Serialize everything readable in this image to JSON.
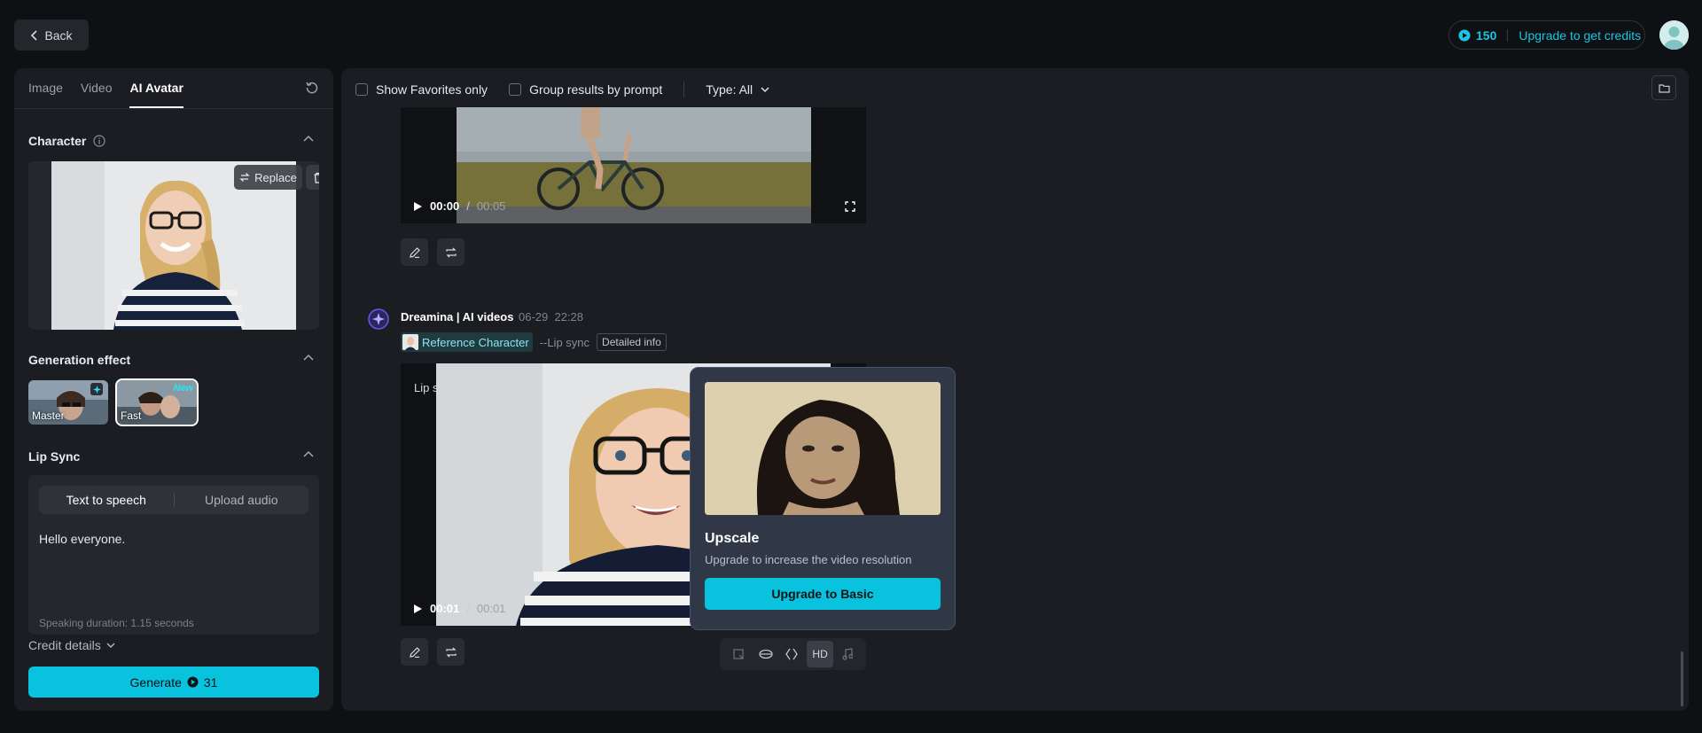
{
  "topbar": {
    "back_label": "Back",
    "credits_count": "150",
    "upgrade_label": "Upgrade to get credits"
  },
  "left": {
    "tabs": [
      {
        "label": "Image"
      },
      {
        "label": "Video"
      },
      {
        "label": "AI Avatar"
      }
    ],
    "character_title": "Character",
    "replace_label": "Replace",
    "generation_effect_title": "Generation effect",
    "effects": [
      {
        "label": "Master"
      },
      {
        "label": "Fast",
        "badge": "New"
      }
    ],
    "lip_sync_title": "Lip Sync",
    "lip_tabs": [
      {
        "label": "Text to speech"
      },
      {
        "label": "Upload audio"
      }
    ],
    "speech_text": "Hello everyone.",
    "duration_text": "Speaking duration: 1.15 seconds",
    "credit_details_label": "Credit details",
    "generate_label": "Generate",
    "generate_cost": "31"
  },
  "main": {
    "toolbar": {
      "show_favorites": "Show Favorites only",
      "group_results": "Group results by prompt",
      "type_filter": "Type: All"
    },
    "video1": {
      "current": "00:00",
      "total": "00:05"
    },
    "generation": {
      "title": "Dreamina | AI videos",
      "date": "06-29",
      "time": "22:28",
      "ref_label": "Reference Character",
      "lip_tag": "--Lip sync",
      "detail_label": "Detailed info"
    },
    "video2": {
      "overlay_label": "Lip sync",
      "current": "00:01",
      "total": "00:01"
    },
    "hover_tools": {
      "hd_label": "HD"
    },
    "popover": {
      "title": "Upscale",
      "description": "Upgrade to increase the video resolution",
      "button_label": "Upgrade to Basic"
    }
  },
  "colors": {
    "accent": "#09c3de",
    "background": "#0f1013",
    "panel": "#1b1d22",
    "popover": "#303847"
  }
}
